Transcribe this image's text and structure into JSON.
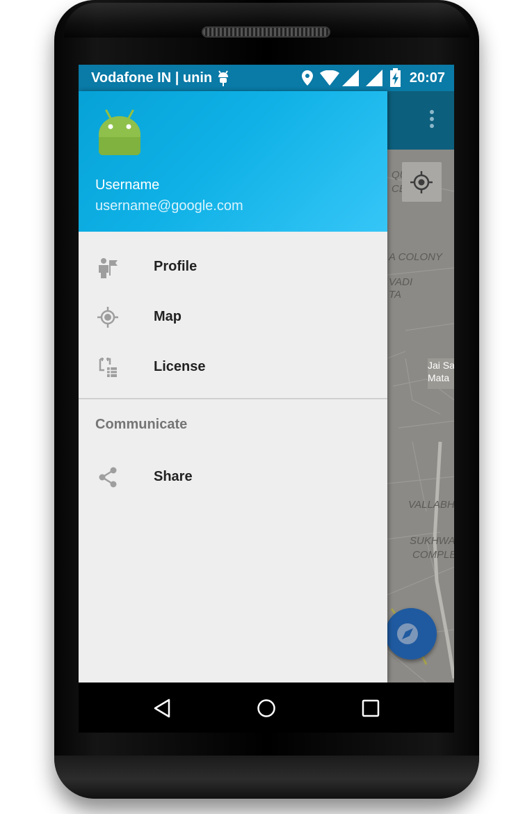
{
  "status_bar": {
    "carrier": "Vodafone IN | unin",
    "time": "20:07",
    "icons": [
      "android-debug-icon",
      "location-icon",
      "wifi-icon",
      "signal-icon",
      "signal-icon",
      "battery-charging-icon"
    ]
  },
  "app_bar": {
    "overflow_icon": "more-vert-icon"
  },
  "drawer": {
    "header": {
      "avatar_icon": "android-icon",
      "name": "Username",
      "email": "username@google.com"
    },
    "items": [
      {
        "label": "Profile",
        "icon": "profile-icon"
      },
      {
        "label": "Map",
        "icon": "gps-icon"
      },
      {
        "label": "License",
        "icon": "license-icon"
      }
    ],
    "section_title": "Communicate",
    "section_items": [
      {
        "label": "Share",
        "icon": "share-icon"
      }
    ]
  },
  "map": {
    "labels": [
      "QUALITY",
      "CENTER",
      "A COLONY",
      "VADI",
      "TA",
      "Jai Sa",
      "Mata",
      "VALLABH",
      "SUKHWA",
      "COMPLE"
    ],
    "locate_icon": "my-location-icon",
    "fab_icon": "compass-icon"
  },
  "nav_bar": {
    "buttons": [
      "back-icon",
      "home-icon",
      "recents-icon"
    ]
  },
  "colors": {
    "status_bar": "#0a7aa6",
    "header_gradient_start": "#06a2d7",
    "header_gradient_end": "#36c6f7",
    "drawer_bg": "#eeeeee",
    "app_bar": "#0c5f7d",
    "fab": "#1f5aa0"
  }
}
